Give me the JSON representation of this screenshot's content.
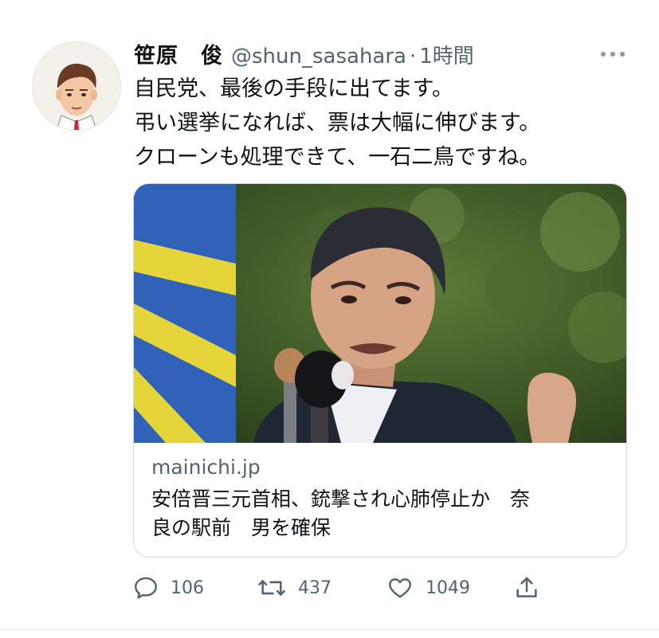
{
  "tweet": {
    "author_name": "笹原　俊",
    "handle": "@shun_sasahara",
    "separator": "·",
    "time": "1時間",
    "lines": [
      "自民党、最後の手段に出てます。",
      "弔い選挙になれば、票は大幅に伸びます。",
      "クローンも処理できて、一石二鳥ですね。"
    ]
  },
  "card": {
    "domain": "mainichi.jp",
    "title_lines": [
      "安倍晋三元首相、銃撃され心肺停止か　奈",
      "良の駅前　男を確保"
    ]
  },
  "actions": {
    "reply_count": "106",
    "retweet_count": "437",
    "like_count": "1049"
  },
  "icons": {
    "reply": "reply-bubble-icon",
    "retweet": "retweet-icon",
    "like": "heart-icon",
    "share": "share-upload-icon",
    "more": "more-dots-icon"
  },
  "colors": {
    "text": "#0f1419",
    "secondary": "#536471",
    "border": "#cfd9de"
  }
}
